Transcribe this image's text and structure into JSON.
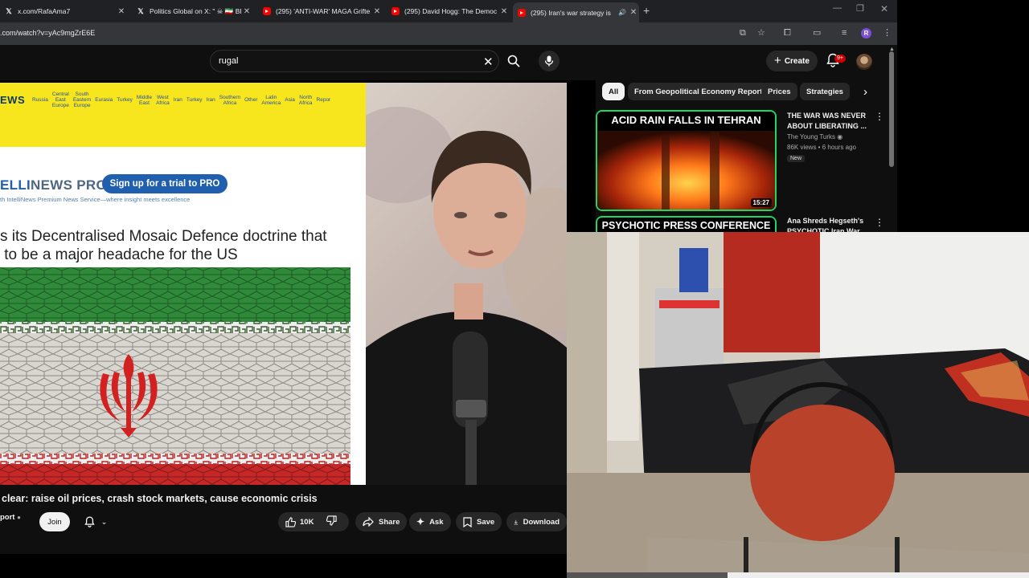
{
  "browser": {
    "tabs": [
      {
        "title": "x.com/RafaAma7",
        "icon": "x-logo-icon",
        "active": false
      },
      {
        "title": "Politics Global on X: \" ☠ 🇮🇷 BRE",
        "icon": "x-logo-icon",
        "active": false
      },
      {
        "title": "(295) 'ANTI-WAR' MAGA Grifte",
        "icon": "youtube-icon",
        "active": false
      },
      {
        "title": "(295) David Hogg: The Democ",
        "icon": "youtube-icon",
        "active": false
      },
      {
        "title": "(295) Iran's war strategy is",
        "icon": "youtube-icon",
        "active": true
      }
    ],
    "url": ".com/watch?v=yAc9mgZrE6E",
    "profile_initial": "R",
    "new_tab": "+"
  },
  "masthead": {
    "search_value": "rugal",
    "create_label": "Create",
    "notification_count": "9+"
  },
  "article": {
    "logo": "EWS",
    "regions": [
      "Russia",
      "Central\nEast\nEurope",
      "South\nEastern\nEurope",
      "Eurasia",
      "Turkey",
      "Middle\nEast",
      "West\nAfrica",
      "Iran",
      "Turkey",
      "Iran",
      "Southern\nAfrica",
      "Other",
      "Latin\nAmerica",
      "Asia",
      "North\nAfrica",
      "Repor"
    ],
    "pro_logo_light": "ELLI",
    "pro_logo_dark": "NEWS PRO",
    "pro_button": "Sign up for a trial to PRO",
    "tagline": "th IntelliNews Premium News Service—where insight meets excellence",
    "headline_line1": "s its Decentralised Mosaic Defence doctrine that",
    "headline_line2": " to be a major headache for the US"
  },
  "video": {
    "title": "clear: raise oil prices, crash stock markets, cause economic crisis",
    "channel": "port",
    "join_label": "Join",
    "likes": "10K",
    "share_label": "Share",
    "ask_label": "Ask",
    "save_label": "Save",
    "download_label": "Download"
  },
  "chips": [
    "All",
    "From Geopolitical Economy Report",
    "Prices",
    "Strategies"
  ],
  "recommendations": [
    {
      "thumb_text": "ACID RAIN FALLS IN TEHRAN",
      "duration": "15:27",
      "title": "THE WAR WAS NEVER ABOUT LIBERATING ...",
      "channel": "The Young Turks",
      "meta": "86K views • 6 hours ago",
      "badge": "New"
    },
    {
      "thumb_text": "PSYCHOTIC PRESS CONFERENCE",
      "title": "Ana Shreds Hegseth's PSYCHOTIC Iran War"
    }
  ],
  "colors": {
    "youtube_red": "#ff0000",
    "thumb_border": "#1ed760",
    "intellinews_blue": "#1f5fae",
    "banner_yellow": "#f7e51d"
  }
}
